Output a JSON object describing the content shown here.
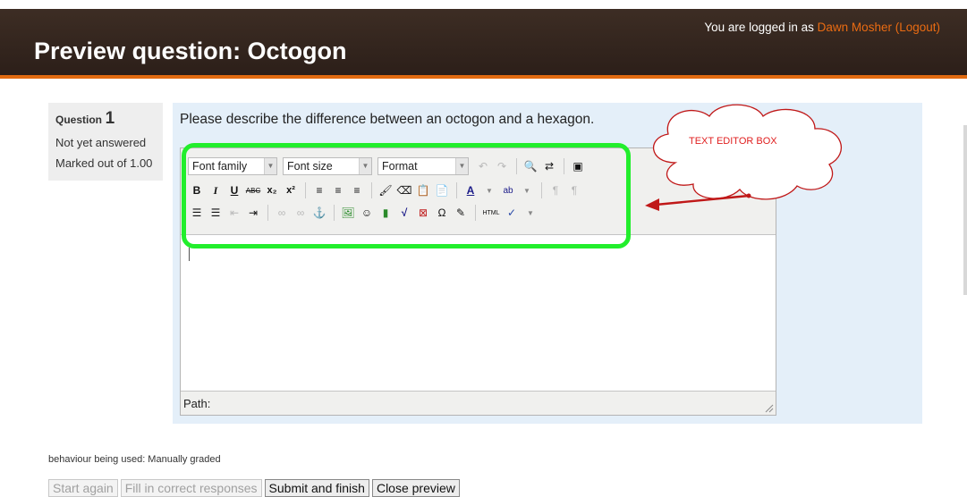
{
  "header": {
    "title": "Preview question: Octogon",
    "login_prefix": "You are logged in as ",
    "user_name": "Dawn Mosher",
    "logout_open": " (",
    "logout_label": "Logout",
    "logout_close": ")"
  },
  "question_info": {
    "question_label": "Question",
    "question_number": "1",
    "state": "Not yet answered",
    "marks": "Marked out of 1.00"
  },
  "question": {
    "prompt": "Please describe the difference between an octogon and a hexagon."
  },
  "editor": {
    "font_family_label": "Font family",
    "font_size_label": "Font size",
    "format_label": "Format",
    "path_label": "Path:",
    "toolbar_text": {
      "bold": "B",
      "italic": "I",
      "underline": "U",
      "strikethrough": "ABC",
      "subscript": "x₂",
      "superscript": "x²",
      "omega": "Ω",
      "html": "HTML"
    }
  },
  "annotation": {
    "callout_text": "TEXT EDITOR BOX",
    "colors": {
      "highlight": "#22ee2c",
      "callout_text": "#e02020",
      "arrow": "#c01818"
    }
  },
  "footer": {
    "behaviour": "behaviour being used: Manually graded",
    "buttons": {
      "start_again": "Start again",
      "fill_correct": "Fill in correct responses",
      "submit_finish": "Submit and finish",
      "close_preview": "Close preview"
    }
  },
  "colors": {
    "header_bg": "#2c1f19",
    "accent": "#e06a10",
    "content_bg": "#e4eff9"
  }
}
